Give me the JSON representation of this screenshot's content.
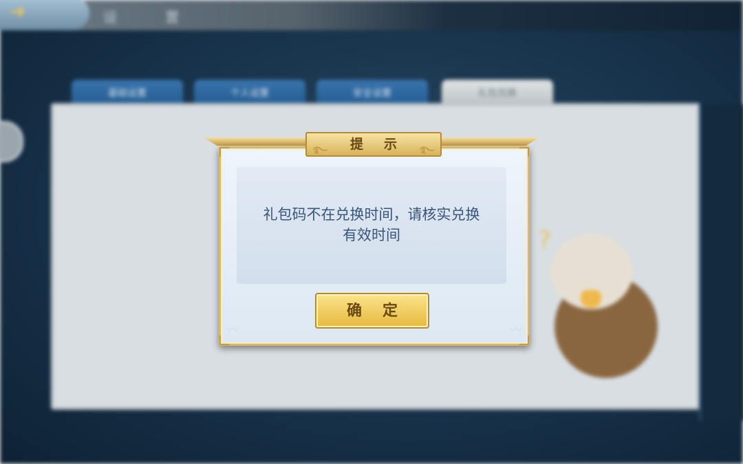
{
  "background": {
    "topbar": {
      "title": "设 置"
    },
    "tabs": [
      {
        "label": "基础设置",
        "active": false
      },
      {
        "label": "个人设置",
        "active": false
      },
      {
        "label": "安全设置",
        "active": false
      },
      {
        "label": "礼包兑换",
        "active": true
      }
    ]
  },
  "dialog": {
    "title": "提示",
    "message_line1": "礼包码不在兑换时间，请核实兑换",
    "message_line2": "有效时间",
    "confirm_label": "确定"
  },
  "colors": {
    "gold": "#e5b93f",
    "dialog_bg": "#eef5fb",
    "message_text": "#39557a",
    "backdrop": "#17324a"
  }
}
